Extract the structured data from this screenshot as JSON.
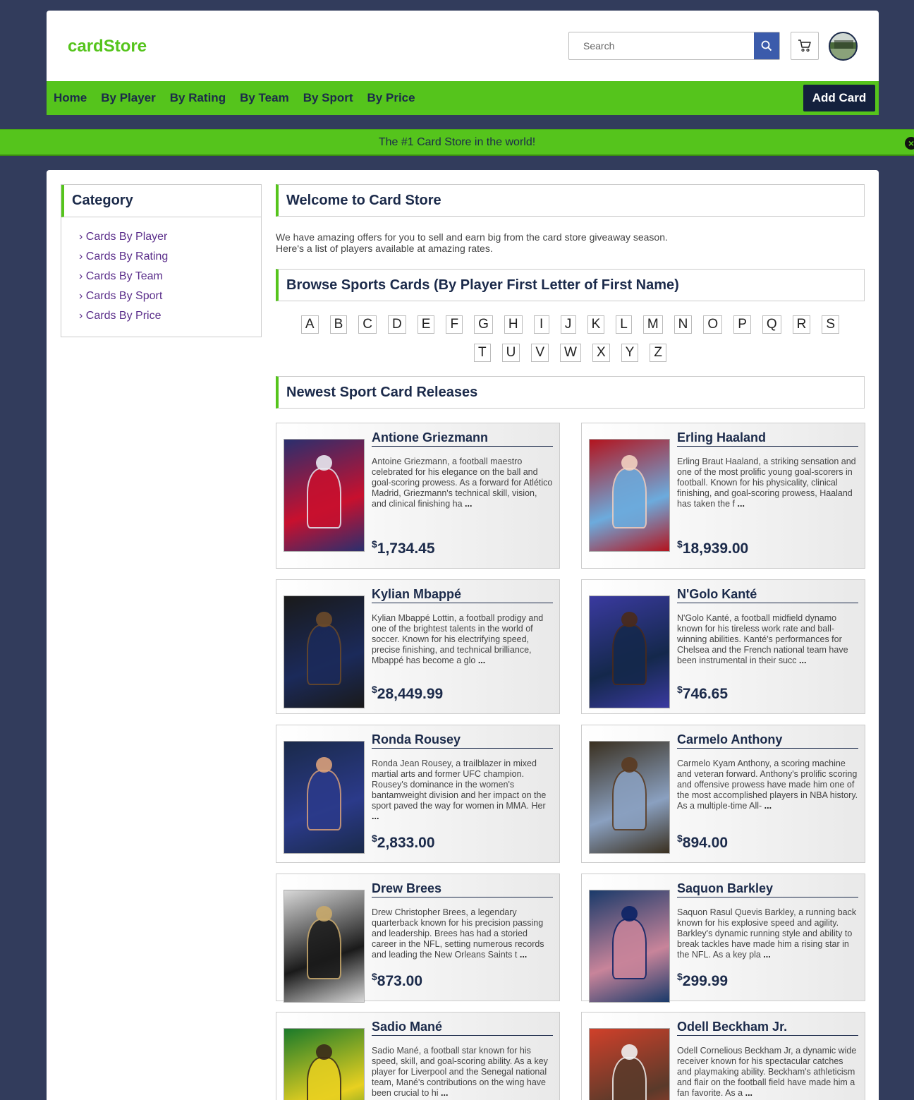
{
  "header": {
    "logo": "cardStore",
    "search_placeholder": "Search"
  },
  "nav": {
    "items": [
      "Home",
      "By Player",
      "By Rating",
      "By Team",
      "By Sport",
      "By Price"
    ],
    "add_card_label": "Add Card"
  },
  "banner": {
    "text": "The #1 Card Store in the world!"
  },
  "sidebar": {
    "title": "Category",
    "items": [
      "Cards By Player",
      "Cards By Rating",
      "Cards By Team",
      "Cards By Sport",
      "Cards By Price"
    ]
  },
  "main": {
    "welcome_title": "Welcome to Card Store",
    "intro_line1": "We have amazing offers for you to sell and earn big from the card store giveaway season.",
    "intro_line2": "Here's a list of players available at amazing rates.",
    "browse_title": "Browse Sports Cards (By Player First Letter of First Name)",
    "letters": [
      "A",
      "B",
      "C",
      "D",
      "E",
      "F",
      "G",
      "H",
      "I",
      "J",
      "K",
      "L",
      "M",
      "N",
      "O",
      "P",
      "Q",
      "R",
      "S",
      "T",
      "U",
      "V",
      "W",
      "X",
      "Y",
      "Z"
    ],
    "newest_title": "Newest Sport Card Releases"
  },
  "cards": [
    {
      "name": "Antione Griezmann",
      "desc": "Antoine Griezmann, a football maestro celebrated for his elegance on the ball and goal-scoring prowess. As a forward for Atlético Madrid, Griezmann's technical skill, vision, and clinical finishing ha",
      "more": "...",
      "currency": "$",
      "price": "1,734.45",
      "palette": [
        "#2a2f6e",
        "#c8102e",
        "#e8e8f0"
      ]
    },
    {
      "name": "Erling Haaland",
      "desc": "Erling Braut Haaland, a striking sensation and one of the most prolific young goal-scorers in football. Known for his physicality, clinical finishing, and goal-scoring prowess, Haaland has taken the f",
      "more": "...",
      "currency": "$",
      "price": "18,939.00",
      "palette": [
        "#b3141e",
        "#6cabdd",
        "#f2d0c0"
      ]
    },
    {
      "name": "Kylian Mbappé",
      "desc": "Kylian Mbappé Lottin, a football prodigy and one of the brightest talents in the world of soccer. Known for his electrifying speed, precise finishing, and technical brilliance, Mbappé has become a glo",
      "more": "...",
      "currency": "$",
      "price": "28,449.99",
      "palette": [
        "#1a1a1a",
        "#1b2a5a",
        "#6b4a2a"
      ]
    },
    {
      "name": "N'Golo Kanté",
      "desc": "N'Golo Kanté, a football midfield dynamo known for his tireless work rate and ball-winning abilities. Kanté's performances for Chelsea and the French national team have been instrumental in their succ",
      "more": "...",
      "currency": "$",
      "price": "746.65",
      "palette": [
        "#3a3aa0",
        "#14284b",
        "#4a2a1a"
      ]
    },
    {
      "name": "Ronda Rousey",
      "desc": "Ronda Jean Rousey, a trailblazer in mixed martial arts and former UFC champion. Rousey's dominance in the women's bantamweight division and her impact on the sport paved the way for women in MMA. Her",
      "more": "...",
      "currency": "$",
      "price": "2,833.00",
      "palette": [
        "#1a2a4a",
        "#2b3a8a",
        "#d9a07a"
      ]
    },
    {
      "name": "Carmelo Anthony",
      "desc": "Carmelo Kyam Anthony, a scoring machine and veteran forward. Anthony's prolific scoring and offensive prowess have made him one of the most accomplished players in NBA history. As a multiple-time All-",
      "more": "...",
      "currency": "$",
      "price": "894.00",
      "palette": [
        "#3a3020",
        "#8aa0c0",
        "#5a3a20"
      ]
    },
    {
      "name": "Drew Brees",
      "desc": "Drew Christopher Brees, a legendary quarterback known for his precision passing and leadership. Brees has had a storied career in the NFL, setting numerous records and leading the New Orleans Saints t",
      "more": "...",
      "currency": "$",
      "price": "873.00",
      "palette": [
        "#d8d8d8",
        "#1a1a1a",
        "#c8a86a"
      ]
    },
    {
      "name": "Saquon Barkley",
      "desc": "Saquon Rasul Quevis Barkley, a running back known for his explosive speed and agility. Barkley's dynamic running style and ability to break tackles have made him a rising star in the NFL. As a key pla",
      "more": "...",
      "currency": "$",
      "price": "299.99",
      "palette": [
        "#1a3a6a",
        "#c8849a",
        "#0b2265"
      ]
    },
    {
      "name": "Sadio Mané",
      "desc": "Sadio Mané, a football star known for his speed, skill, and goal-scoring ability. As a key player for Liverpool and the Senegal national team, Mané's contributions on the wing have been crucial to hi",
      "more": "...",
      "currency": "$",
      "price": "",
      "palette": [
        "#1a7a2a",
        "#e8d020",
        "#3a2a1a"
      ]
    },
    {
      "name": "Odell Beckham Jr.",
      "desc": "Odell Cornelious Beckham Jr, a dynamic wide receiver known for his spectacular catches and playmaking ability. Beckham's athleticism and flair on the football field have made him a fan favorite. As a",
      "more": "...",
      "currency": "$",
      "price": "",
      "palette": [
        "#d0402a",
        "#5a3a2a",
        "#f0f0f0"
      ]
    }
  ]
}
